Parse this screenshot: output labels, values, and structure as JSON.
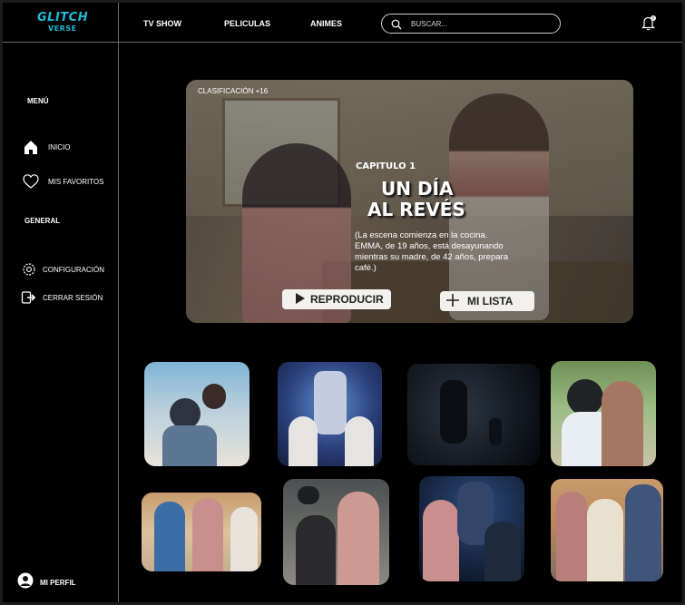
{
  "logo": {
    "line1": "GLITCH",
    "line2": "VERSE"
  },
  "nav": {
    "tv_show": "TV SHOW",
    "peliculas": "PELICULAS",
    "animes": "ANIMES"
  },
  "search": {
    "placeholder": "BUSCAR..."
  },
  "sidebar": {
    "menu_title": "MENÚ",
    "items": [
      {
        "label": "INICIO",
        "icon": "home-icon"
      },
      {
        "label": "MIS FAVORITOS",
        "icon": "heart-icon"
      }
    ],
    "general_title": "GENERAL",
    "general_items": [
      {
        "label": "CONFIGURACIÓN",
        "icon": "gear-icon"
      },
      {
        "label": "CERRAR SESIÓN",
        "icon": "logout-icon"
      }
    ],
    "profile_label": "MI PERFIL"
  },
  "hero": {
    "rating": "CLASIFICACIÓN +16",
    "chapter": "CAPITULO 1",
    "title_line1": "UN DÍA",
    "title_line2": "AL REVÉS",
    "description": "(La escena comienza en la cocina. EMMA, de 19 años, está desayunando mientras su madre, de 42 años, prepara café.)",
    "play_label": "REPRODUCIR",
    "list_label": "MI LISTA"
  },
  "colors": {
    "background": "#000000",
    "accent": "#1fb8d6",
    "button": "#f2f1ee",
    "divider": "#6a6a6a"
  }
}
